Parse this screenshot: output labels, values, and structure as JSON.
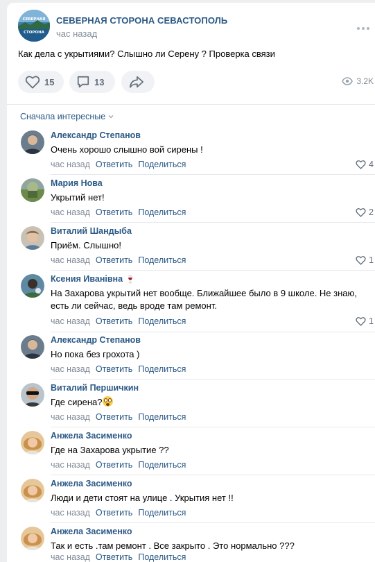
{
  "post": {
    "group_name": "СЕВЕРНАЯ СТОРОНА СЕВАСТОПОЛЬ",
    "group_avatar_text": "СТОРОНА",
    "time": "час назад",
    "text": "Как дела с укрытиями? Слышно ли Серену ? Проверка связи",
    "likes": "15",
    "comments": "13",
    "views": "3.2K"
  },
  "comments_section": {
    "sort_label": "Сначала интересные"
  },
  "actions": {
    "reply": "Ответить",
    "share": "Поделиться"
  },
  "comments": [
    {
      "author": "Александр Степанов",
      "text": "Очень хорошо слышно вой сирены !",
      "time": "час назад",
      "likes": "4"
    },
    {
      "author": "Мария Нова",
      "text": "Укрытий нет!",
      "time": "час назад",
      "likes": "2"
    },
    {
      "author": "Виталий Шандыба",
      "text": "Приём. Слышно!",
      "time": "час назад",
      "likes": "1"
    },
    {
      "author": "Ксения Иванівна",
      "author_emoji": "🍷",
      "text": "На Захарова укрытий нет вообще. Ближайшее было в 9 школе. Не знаю, есть ли сейчас, ведь вроде там ремонт.",
      "time": "час назад",
      "likes": "1"
    },
    {
      "author": "Александр Степанов",
      "text": "Но пока без грохота )",
      "time": "час назад",
      "likes": ""
    },
    {
      "author": "Виталий Першичкин",
      "text": "Где сирена?",
      "time": "час назад",
      "likes": ""
    },
    {
      "author": "Анжела Засименко",
      "text": "Где на Захарова укрытие ??",
      "time": "час назад",
      "likes": ""
    },
    {
      "author": "Анжела Засименко",
      "text": "Люди и дети стоят на улице . Укрытия нет !!",
      "time": "час назад",
      "likes": ""
    },
    {
      "author": "Анжела Засименко",
      "text": "Так и есть .там ремонт . Все закрыто . Это нормально ???",
      "time": "час назад",
      "likes": ""
    }
  ]
}
